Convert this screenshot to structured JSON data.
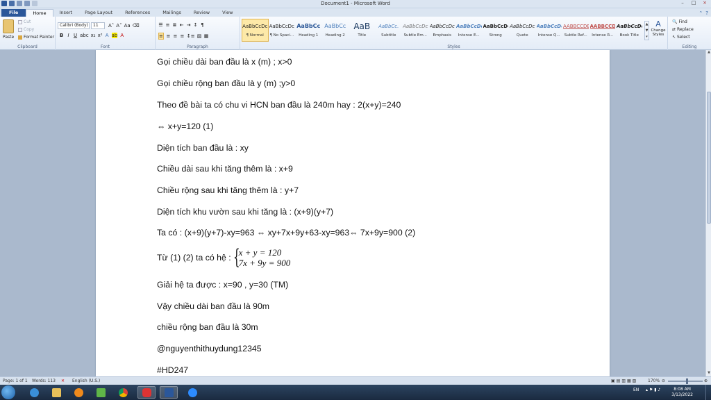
{
  "window": {
    "title": "Document1 - Microsoft Word",
    "controls": [
      "–",
      "□",
      "×"
    ]
  },
  "tabs": [
    "File",
    "Home",
    "Insert",
    "Page Layout",
    "References",
    "Mailings",
    "Review",
    "View"
  ],
  "active_tab": "Home",
  "ribbon": {
    "clipboard": {
      "label": "Clipboard",
      "paste": "Paste",
      "cut": "Cut",
      "copy": "Copy",
      "format_painter": "Format Painter"
    },
    "font": {
      "label": "Font",
      "family": "Calibri (Body)",
      "size": "11"
    },
    "paragraph": {
      "label": "Paragraph"
    },
    "styles": {
      "label": "Styles",
      "items": [
        {
          "sample": "AaBbCcDc",
          "name": "¶ Normal"
        },
        {
          "sample": "AaBbCcDc",
          "name": "¶ No Spaci..."
        },
        {
          "sample": "AaBbCc",
          "name": "Heading 1"
        },
        {
          "sample": "AaBbCc",
          "name": "Heading 2"
        },
        {
          "sample": "AaB",
          "name": "Title"
        },
        {
          "sample": "AaBbCc.",
          "name": "Subtitle"
        },
        {
          "sample": "AaBbCcDc",
          "name": "Subtle Em..."
        },
        {
          "sample": "AaBbCcDc",
          "name": "Emphasis"
        },
        {
          "sample": "AaBbCcDc",
          "name": "Intense E..."
        },
        {
          "sample": "AaBbCcDc",
          "name": "Strong"
        },
        {
          "sample": "AaBbCcDc",
          "name": "Quote"
        },
        {
          "sample": "AaBbCcDc",
          "name": "Intense Q..."
        },
        {
          "sample": "AABBCCDE",
          "name": "Subtle Ref..."
        },
        {
          "sample": "AABBCCDE",
          "name": "Intense R..."
        },
        {
          "sample": "AaBbCcDc",
          "name": "Book Title"
        }
      ],
      "change_styles": "Change Styles"
    },
    "editing": {
      "label": "Editing",
      "find": "Find",
      "replace": "Replace",
      "select": "Select"
    }
  },
  "document": {
    "lines": [
      "Gọi chiều dài ban đầu là x (m) ; x>0",
      "Gọi chiều rộng ban đầu là y (m) ;y>0",
      "Theo đề bài ta có chu vi HCN ban đầu là 240m hay : 2(x+y)=240",
      "⇔ x+y=120 (1)",
      "Diện tích ban đầu là : xy",
      "Chiều dài sau khi tăng thêm là : x+9",
      "Chiều rộng sau khi tăng thêm là : y+7",
      "Diện tích khu vườn sau khi tăng là : (x+9)(y+7)",
      "Ta có : (x+9)(y+7)-xy=963 ⇔ xy+7x+9y+63-xy=963⇔ 7x+9y=900 (2)"
    ],
    "system_label": "Từ (1) (2) ta có hệ :",
    "system_eq1": "x + y = 120",
    "system_eq2": "7x + 9y = 900",
    "lines_after": [
      "Giải hệ ta được : x=90 , y=30 (TM)",
      "Vậy chiều dài ban đầu là 90m",
      "chiều rộng ban đầu là 30m",
      "@nguyenthithuydung12345",
      "#HD247"
    ]
  },
  "statusbar": {
    "page": "Page: 1 of 1",
    "words": "Words: 113",
    "language": "English (U.S.)",
    "zoom": "170%"
  },
  "taskbar": {
    "lang": "EN",
    "time": "8:08 AM",
    "date": "3/13/2022"
  }
}
